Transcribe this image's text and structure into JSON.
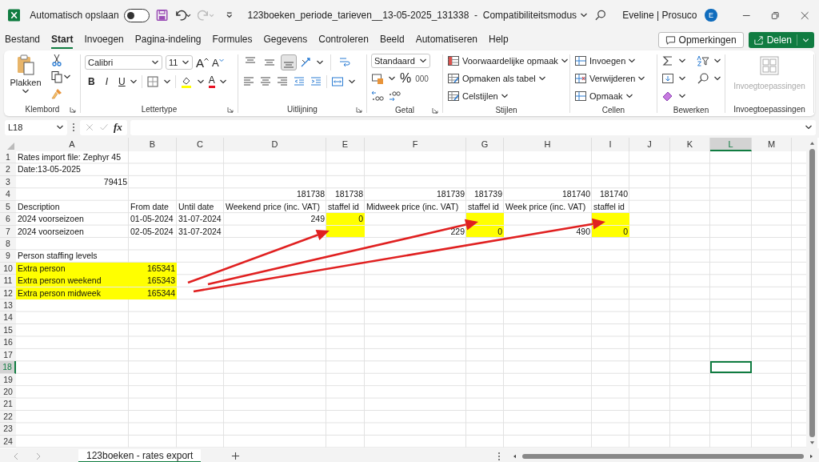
{
  "titlebar": {
    "autosave_label": "Automatisch opslaan",
    "autosave_on": false,
    "title": "123boeken_periode_tarieven__13-05-2025_131338  -  Compatibiliteitsmodus",
    "user": "Eveline | Prosuco",
    "avatar": "E"
  },
  "menu_tabs": [
    {
      "label": "Bestand",
      "selected": false
    },
    {
      "label": "Start",
      "selected": true
    },
    {
      "label": "Invoegen",
      "selected": false
    },
    {
      "label": "Pagina-indeling",
      "selected": false
    },
    {
      "label": "Formules",
      "selected": false
    },
    {
      "label": "Gegevens",
      "selected": false
    },
    {
      "label": "Controleren",
      "selected": false
    },
    {
      "label": "Beeld",
      "selected": false
    },
    {
      "label": "Automatiseren",
      "selected": false
    },
    {
      "label": "Help",
      "selected": false
    }
  ],
  "comments_button": "Opmerkingen",
  "share_button": "Delen",
  "ribbon": {
    "klembord": {
      "paste": "Plakken",
      "label": "Klembord"
    },
    "lettertype": {
      "font": "Calibri",
      "size": "11",
      "grow": "A",
      "shrink": "A",
      "bold": "B",
      "italic": "I",
      "underline": "U",
      "font_color": "A",
      "label": "Lettertype"
    },
    "uitlijning": {
      "vertical_align": [
        {
          "selected": false
        },
        {
          "selected": false
        },
        {
          "selected": true
        }
      ],
      "label": "Uitlijning"
    },
    "getal": {
      "format": "Standaard",
      "percent": "%",
      "thousands": "000",
      "label": "Getal"
    },
    "stijlen": {
      "items": [
        "Voorwaardelijke opmaak",
        "Opmaken als tabel",
        "Celstijlen"
      ],
      "label": "Stijlen"
    },
    "cellen": {
      "items": [
        "Invoegen",
        "Verwijderen",
        "Opmaak"
      ],
      "label": "Cellen"
    },
    "bewerken": {
      "label": "Bewerken"
    },
    "invoegtoepassingen": {
      "button": "Invoegtoepassingen",
      "disabled": true,
      "label": "Invoegtoepassingen"
    }
  },
  "formula_bar": {
    "name_box": "L18",
    "fx": "fx"
  },
  "grid": {
    "columns": [
      {
        "label": "A",
        "selected": false
      },
      {
        "label": "B",
        "selected": false
      },
      {
        "label": "C",
        "selected": false
      },
      {
        "label": "D",
        "selected": false
      },
      {
        "label": "E",
        "selected": false
      },
      {
        "label": "F",
        "selected": false
      },
      {
        "label": "G",
        "selected": false
      },
      {
        "label": "H",
        "selected": false
      },
      {
        "label": "I",
        "selected": false
      },
      {
        "label": "J",
        "selected": false
      },
      {
        "label": "K",
        "selected": false
      },
      {
        "label": "L",
        "selected": true
      },
      {
        "label": "M",
        "selected": false
      }
    ],
    "rows": [
      {
        "label": "1",
        "selected": false,
        "cells": [
          {
            "text": "Rates import file: Zephyr 45",
            "kind": "text",
            "highlighted": false
          }
        ]
      },
      {
        "label": "2",
        "selected": false,
        "cells": [
          {
            "text": "Date:13-05-2025",
            "kind": "text",
            "highlighted": false
          }
        ]
      },
      {
        "label": "3",
        "selected": false,
        "cells": [
          {
            "text": "79415",
            "kind": "number",
            "highlighted": false
          }
        ]
      },
      {
        "label": "4",
        "selected": false,
        "cells": [
          {
            "highlighted": false
          },
          {
            "highlighted": false
          },
          {
            "highlighted": false
          },
          {
            "text": "181738",
            "kind": "number",
            "highlighted": false
          },
          {
            "text": "181738",
            "kind": "number",
            "highlighted": false
          },
          {
            "text": "181739",
            "kind": "number",
            "highlighted": false
          },
          {
            "text": "181739",
            "kind": "number",
            "highlighted": false
          },
          {
            "text": "181740",
            "kind": "number",
            "highlighted": false
          },
          {
            "text": "181740",
            "kind": "number",
            "highlighted": false
          }
        ]
      },
      {
        "label": "5",
        "selected": false,
        "cells": [
          {
            "text": "Description",
            "kind": "text",
            "highlighted": false
          },
          {
            "text": "From date",
            "kind": "text",
            "highlighted": false
          },
          {
            "text": "Until date",
            "kind": "text",
            "highlighted": false
          },
          {
            "text": "Weekend price (inc. VAT)",
            "kind": "text",
            "highlighted": false
          },
          {
            "text": "staffel id",
            "kind": "text",
            "highlighted": false
          },
          {
            "text": "Midweek price (inc. VAT)",
            "kind": "text",
            "highlighted": false
          },
          {
            "text": "staffel id",
            "kind": "text",
            "highlighted": false
          },
          {
            "text": "Week price (inc. VAT)",
            "kind": "text",
            "highlighted": false
          },
          {
            "text": "staffel id",
            "kind": "text",
            "highlighted": false
          }
        ]
      },
      {
        "label": "6",
        "selected": false,
        "cells": [
          {
            "text": "2024 voorseizoen",
            "kind": "text",
            "highlighted": false
          },
          {
            "text": "01-05-2024",
            "kind": "text",
            "highlighted": false
          },
          {
            "text": "31-07-2024",
            "kind": "text",
            "highlighted": false
          },
          {
            "text": "249",
            "kind": "number",
            "highlighted": false
          },
          {
            "text": "0",
            "kind": "number",
            "highlighted": true
          },
          {
            "highlighted": false
          },
          {
            "highlighted": true
          },
          {
            "highlighted": false
          },
          {
            "highlighted": true
          }
        ]
      },
      {
        "label": "7",
        "selected": false,
        "cells": [
          {
            "text": "2024 voorseizoen",
            "kind": "text",
            "highlighted": false
          },
          {
            "text": "02-05-2024",
            "kind": "text",
            "highlighted": false
          },
          {
            "text": "31-07-2024",
            "kind": "text",
            "highlighted": false
          },
          {
            "highlighted": false
          },
          {
            "highlighted": true
          },
          {
            "text": "229",
            "kind": "number",
            "highlighted": false
          },
          {
            "text": "0",
            "kind": "number",
            "highlighted": true
          },
          {
            "text": "490",
            "kind": "number",
            "highlighted": false
          },
          {
            "text": "0",
            "kind": "number",
            "highlighted": true
          }
        ]
      },
      {
        "label": "8",
        "selected": false
      },
      {
        "label": "9",
        "selected": false,
        "cells": [
          {
            "text": "Person staffing levels",
            "kind": "text",
            "highlighted": false
          }
        ]
      },
      {
        "label": "10",
        "selected": false,
        "cells": [
          {
            "text": "Extra person",
            "kind": "text",
            "highlighted": true
          },
          {
            "text": "165341",
            "kind": "number",
            "highlighted": true
          }
        ]
      },
      {
        "label": "11",
        "selected": false,
        "cells": [
          {
            "text": "Extra person weekend",
            "kind": "text",
            "highlighted": true
          },
          {
            "text": "165343",
            "kind": "number",
            "highlighted": true
          }
        ]
      },
      {
        "label": "12",
        "selected": false,
        "cells": [
          {
            "text": "Extra person midweek",
            "kind": "text",
            "highlighted": true
          },
          {
            "text": "165344",
            "kind": "number",
            "highlighted": true
          }
        ]
      },
      {
        "label": "13",
        "selected": false
      },
      {
        "label": "14",
        "selected": false
      },
      {
        "label": "15",
        "selected": false
      },
      {
        "label": "16",
        "selected": false
      },
      {
        "label": "17",
        "selected": false
      },
      {
        "label": "18",
        "selected": true
      },
      {
        "label": "19",
        "selected": false
      },
      {
        "label": "20",
        "selected": false
      },
      {
        "label": "21",
        "selected": false
      },
      {
        "label": "22",
        "selected": false
      },
      {
        "label": "23",
        "selected": false
      },
      {
        "label": "24",
        "selected": false
      }
    ]
  },
  "sheet_tabs": [
    {
      "label": "123boeken - rates export",
      "selected": true
    }
  ]
}
